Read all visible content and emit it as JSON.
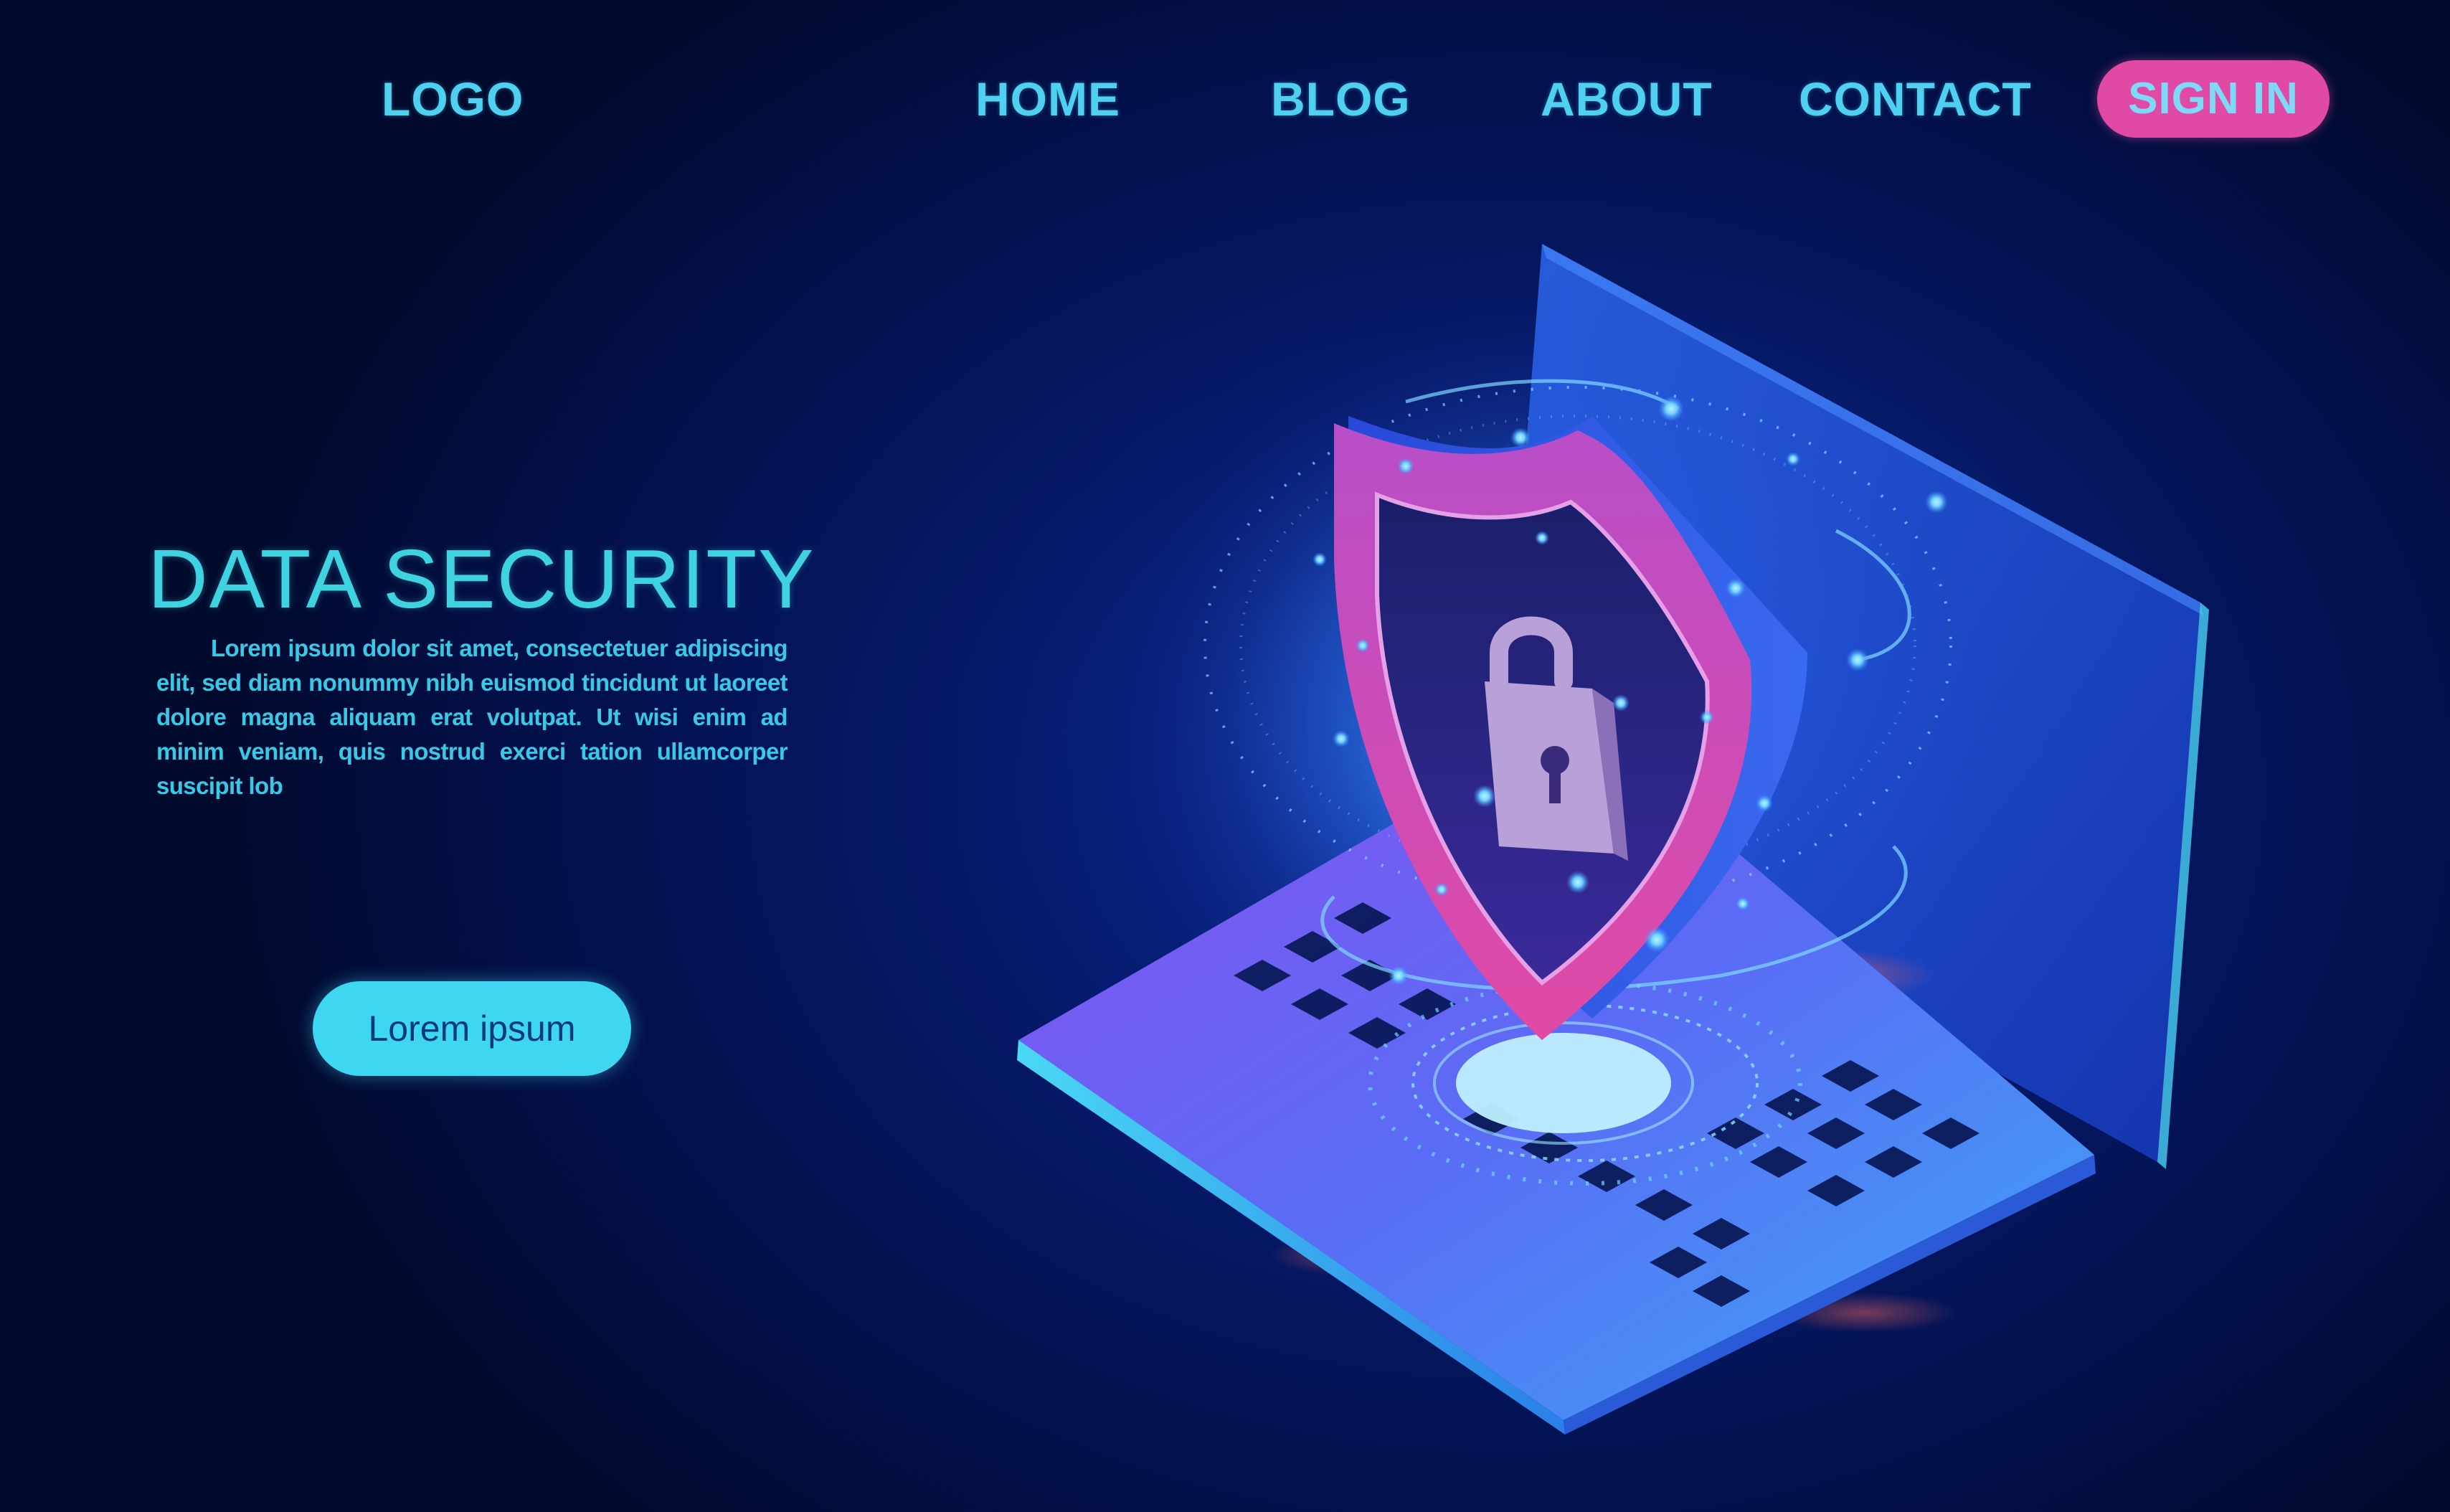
{
  "nav": {
    "logo": "LOGO",
    "items": [
      {
        "label": "HOME"
      },
      {
        "label": "BLOG"
      },
      {
        "label": "ABOUT"
      },
      {
        "label": "CONTACT"
      }
    ],
    "signin_label": "SIGN IN"
  },
  "hero": {
    "title": "DATA SECURITY",
    "body": "Lorem ipsum dolor sit amet, consectetuer adipiscing elit, sed diam nonummy nibh euismod tincidunt ut laoreet dolore magna aliquam erat volutpat. Ut wisi enim ad minim veniam, quis nostrud exerci tation ullamcorper suscipit lob",
    "cta_label": "Lorem ipsum"
  },
  "illustration": {
    "icons": [
      "laptop-icon",
      "shield-icon",
      "padlock-icon"
    ]
  },
  "colors": {
    "background": "#03104a",
    "accent_cyan": "#3fd2e0",
    "signin_pink": "#e04aa6",
    "cta_cyan": "#3fd6f2"
  }
}
